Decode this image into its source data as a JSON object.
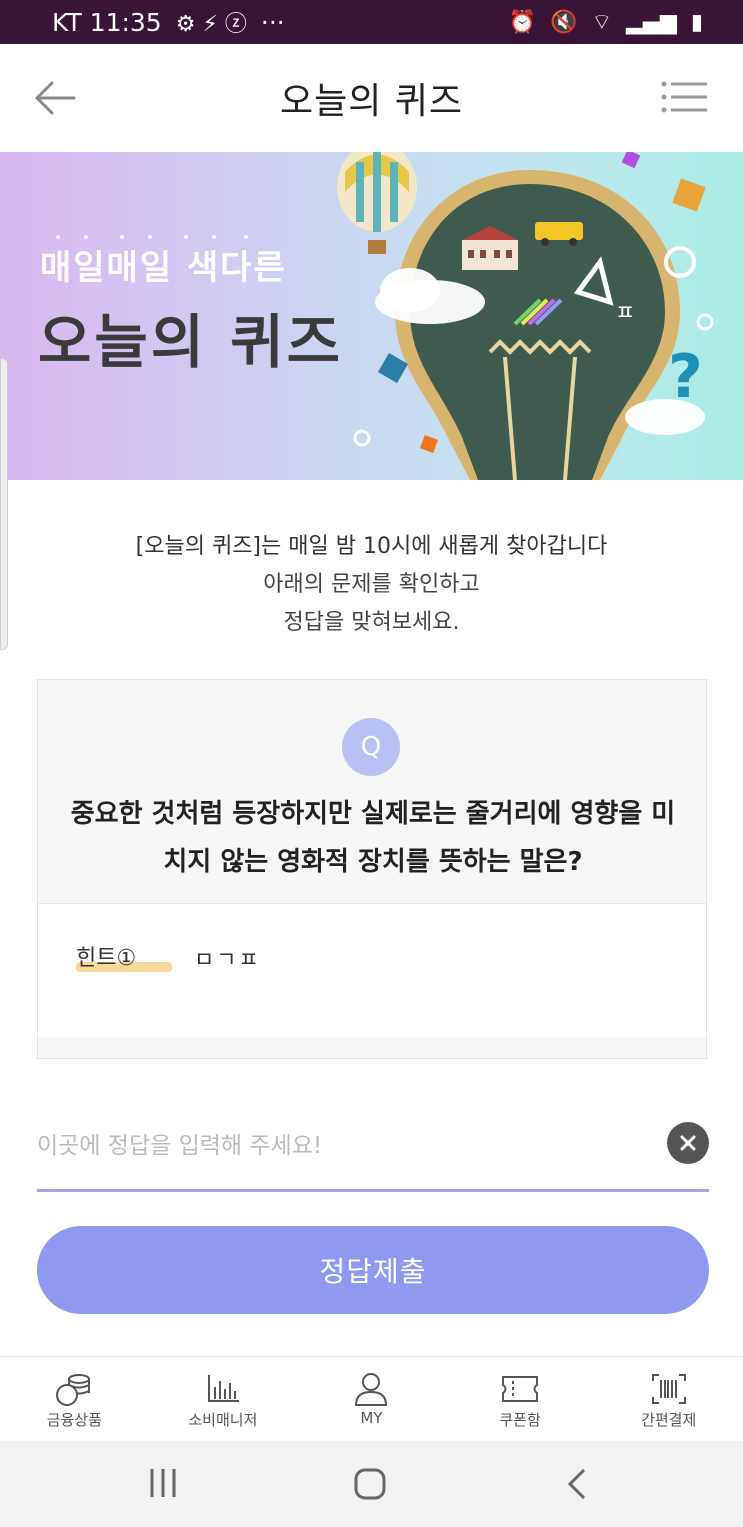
{
  "status_bar": {
    "carrier_time": "KT 11:35",
    "dots": "···"
  },
  "header": {
    "title": "오늘의 퀴즈"
  },
  "banner": {
    "subtitle": "매일매일 색다른",
    "title": "오늘의 퀴즈"
  },
  "intro": {
    "line1": "[오늘의 퀴즈]는 매일 밤 10시에 새롭게 찾아갑니다",
    "line2": "아래의 문제를 확인하고",
    "line3": "정답을 맞혀보세요."
  },
  "question": {
    "badge": "Q",
    "text_line1": "중요한 것처럼 등장하지만 실제로는 줄거리에 영향을 미",
    "text_line2": "치지 않는 영화적 장치를 뜻하는 말은?"
  },
  "hint": {
    "label": "힌트①",
    "value": "ㅁㄱㅍ"
  },
  "answer_input": {
    "value": "",
    "placeholder": "이곳에 정답을 입력해 주세요!"
  },
  "submit_label": "정답제출",
  "tabbar": {
    "items": [
      {
        "label": "금융상품",
        "icon": "coins-icon"
      },
      {
        "label": "소비매니저",
        "icon": "bar-chart-icon"
      },
      {
        "label": "MY",
        "icon": "person-icon"
      },
      {
        "label": "쿠폰함",
        "icon": "ticket-icon"
      },
      {
        "label": "간편결제",
        "icon": "barcode-icon"
      }
    ]
  },
  "colors": {
    "status_bar": "#3a1436",
    "accent": "#8f99ef",
    "badge": "#b9c0f3",
    "hint_highlight": "#f6d488"
  }
}
